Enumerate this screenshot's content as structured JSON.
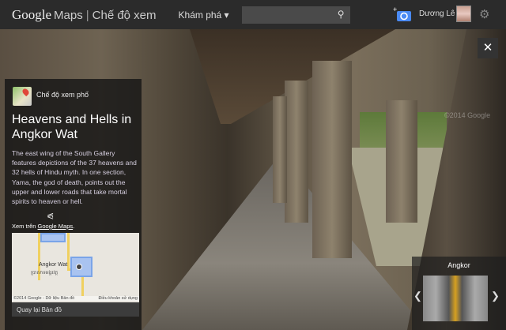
{
  "header": {
    "logo_google": "Google",
    "logo_maps": "Maps",
    "separator": "|",
    "mode": "Chế độ xem",
    "explore": "Khám phá ▾",
    "search_placeholder": "",
    "user_name": "Dương Lê"
  },
  "pano": {
    "watermark": "©2014 Google"
  },
  "card": {
    "mode_label": "Chế độ xem phố",
    "title": "Heavens and Hells in Angkor Wat",
    "description": "The east wing of the South Gallery features depictions of the 37 heavens and 32 hells of Hindu myth. In one section, Yama, the god of death, points out the upper and lower roads that take mortal spirits to heaven or hell.",
    "view_on": "Xem trên",
    "view_link": "Google Maps",
    "view_suffix": ".",
    "map": {
      "place": "Angkor Wat",
      "place_local": "ប្រាសាទអង្គរវត្ត",
      "copyright": "©2014 Google - Dữ liệu Bản đồ",
      "terms": "Điều khoản sử dụng"
    },
    "back": "Quay lại Bản đồ"
  },
  "thumbnail": {
    "title": "Angkor"
  }
}
